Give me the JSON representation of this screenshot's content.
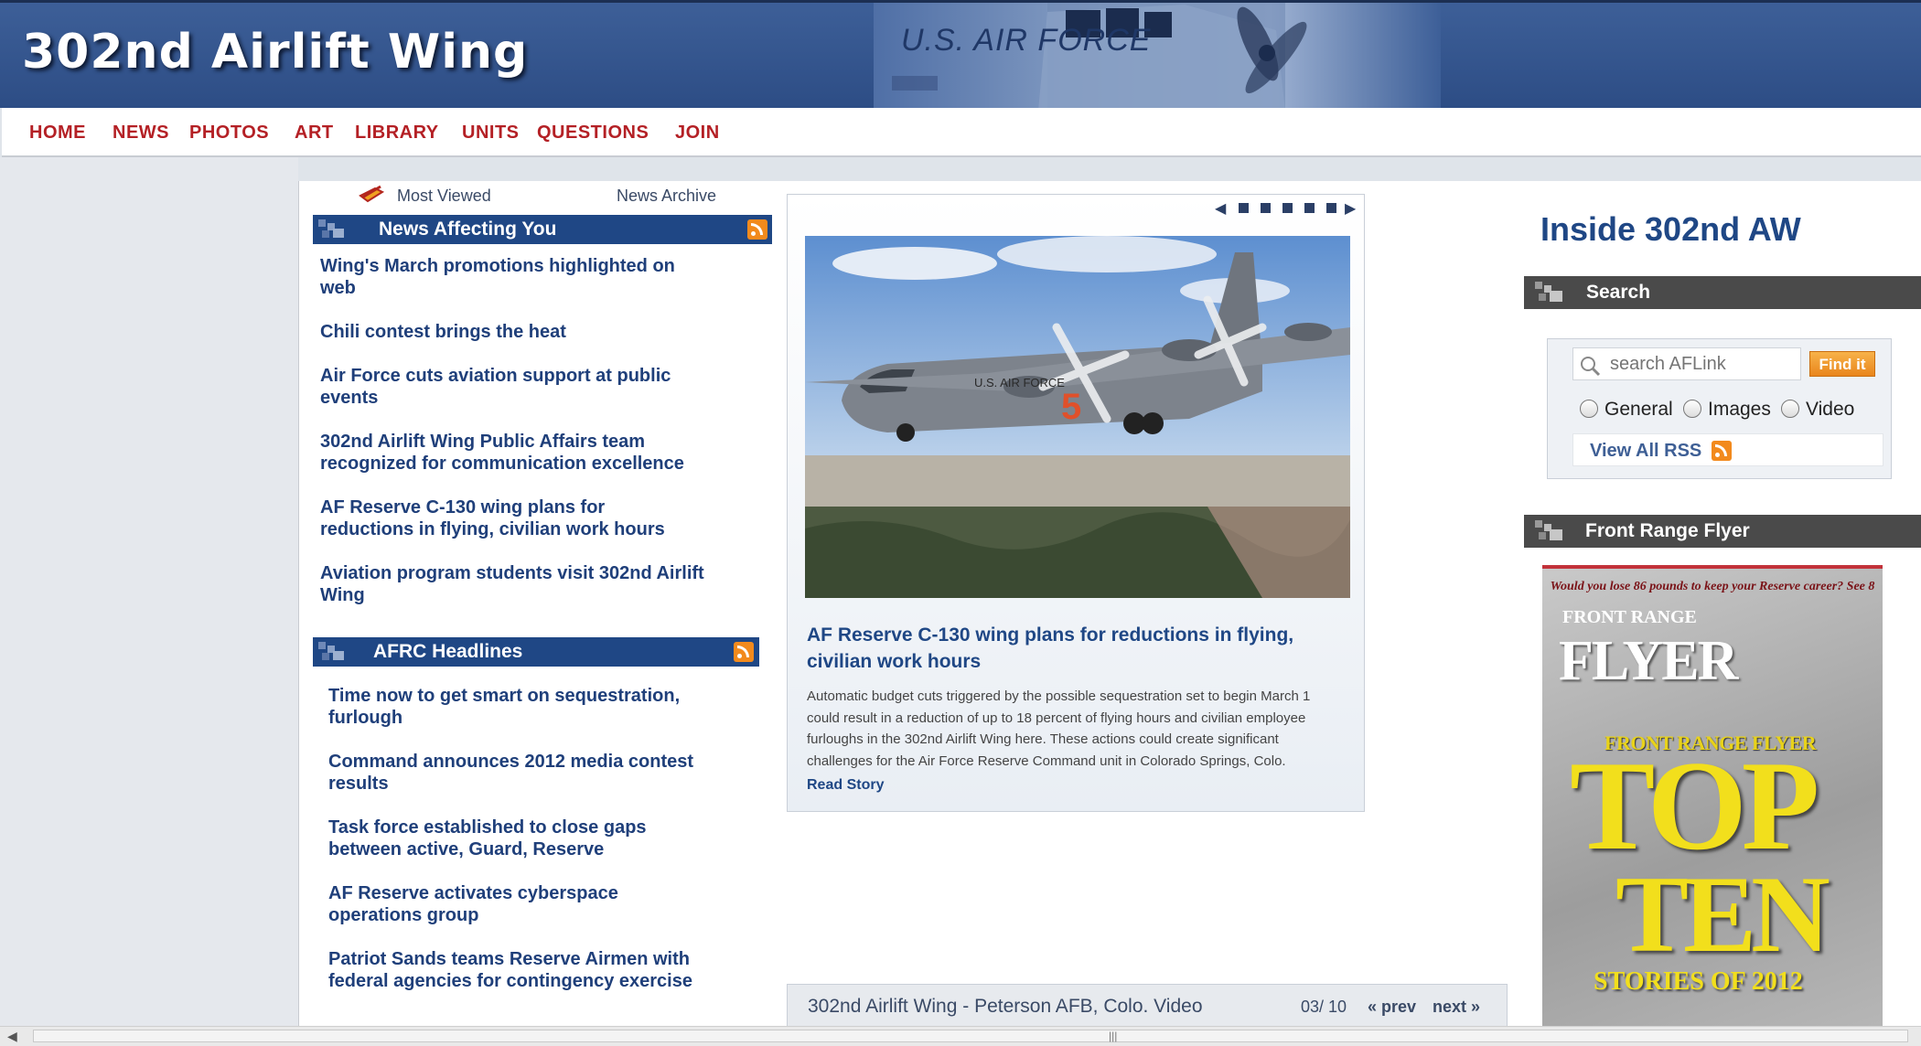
{
  "header": {
    "title": "302nd Airlift Wing",
    "banner_text": "U.S. AIR FORCE"
  },
  "nav": {
    "items": [
      "HOME",
      "NEWS",
      "PHOTOS",
      "ART",
      "LIBRARY",
      "UNITS",
      "QUESTIONS",
      "JOIN"
    ]
  },
  "news": {
    "tab_most_viewed": "Most Viewed",
    "tab_archive": "News Archive",
    "affecting_title": "News Affecting You",
    "affecting_items": [
      [
        "Wing's March promotions highlighted on",
        "web"
      ],
      [
        "Chili contest brings the heat"
      ],
      [
        "Air Force cuts aviation support at public",
        "events"
      ],
      [
        "302nd Airlift Wing Public Affairs team",
        "recognized for communication excellence"
      ],
      [
        "AF Reserve C-130 wing plans for",
        "reductions in flying, civilian work hours"
      ],
      [
        "Aviation program students visit 302nd Airlift",
        "Wing"
      ]
    ],
    "afrc_title": "AFRC Headlines",
    "afrc_items": [
      [
        "Time now to get smart on sequestration,",
        "furlough"
      ],
      [
        "Command announces 2012 media contest",
        "results"
      ],
      [
        "Task force established to close gaps",
        "between active, Guard, Reserve"
      ],
      [
        "AF Reserve activates cyberspace",
        "operations group"
      ],
      [
        "Patriot Sands teams Reserve Airmen with",
        "federal agencies for contingency exercise"
      ]
    ]
  },
  "feature": {
    "title_lines": [
      "AF Reserve C-130 wing plans for reductions in flying,",
      "civilian work hours"
    ],
    "summary_lines": [
      "Automatic budget cuts triggered by the possible sequestration set to begin March 1",
      "could result in a reduction of up to 18 percent of flying hours and civilian employee",
      "furloughs in the 302nd Airlift Wing here. These actions could create significant",
      "challenges for the Air Force Reserve Command unit in Colorado Springs, Colo."
    ],
    "read_story": "Read Story",
    "aircraft_marking": "U.S. AIR FORCE",
    "tail_number": "5"
  },
  "video": {
    "title": "302nd Airlift Wing - Peterson AFB, Colo. Video",
    "counter": "03/ 10",
    "prev": "« prev",
    "next": "next »"
  },
  "sidebar": {
    "title": "Inside 302nd AW",
    "search_header": "Search",
    "search_placeholder": "search AFLink",
    "find_label": "Find it",
    "radio_options": [
      "General",
      "Images",
      "Video"
    ],
    "view_rss": "View All RSS",
    "flyer_header": "Front Range Flyer",
    "flyer": {
      "top_line": "Would you lose 86 pounds to keep your Reserve career? See 8",
      "brand_line1": "FRONT RANGE",
      "brand_line2": "FLYER",
      "subtitle": "FRONT RANGE FLYER",
      "big_line1": "TOP",
      "big_line2": "TEN",
      "bottom": "STORIES OF 2012"
    }
  },
  "colors": {
    "header_blue": "#2d4d85",
    "nav_red": "#b42025",
    "section_blue": "#1f4785",
    "rss_orange": "#f28a1d"
  }
}
